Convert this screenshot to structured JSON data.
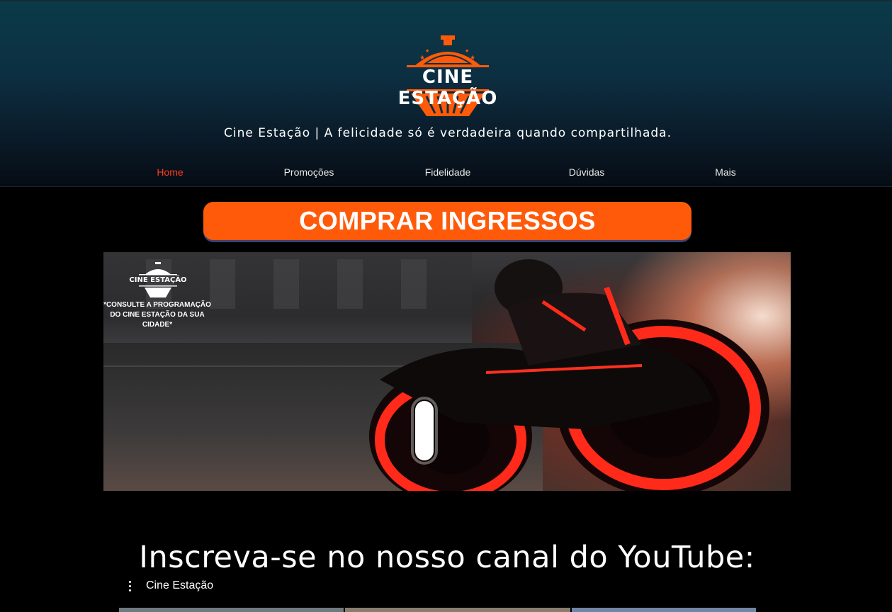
{
  "header": {
    "logo_text": "CINE ESTAÇÃO",
    "tagline": "Cine Estação |  A felicidade só é verdadeira quando compartilhada.",
    "brand_color": "#ff5a0a"
  },
  "nav": {
    "items": [
      {
        "label": "Home",
        "active": true
      },
      {
        "label": "Promoções",
        "active": false
      },
      {
        "label": "Fidelidade",
        "active": false
      },
      {
        "label": "Dúvidas",
        "active": false
      },
      {
        "label": "Mais",
        "active": false
      }
    ],
    "active_color": "#ff3b1f"
  },
  "cta": {
    "label": "COMPRAR INGRESSOS"
  },
  "banner": {
    "logo_text": "CINE ESTAÇÃO",
    "note": "*CONSULTE A PROGRAMAÇÃO DO CINE ESTAÇÃO DA SUA CIDADE*"
  },
  "youtube": {
    "title": "Inscreva-se no nosso canal do YouTube:",
    "channel_name": "Cine Estação",
    "menu_icon": "kebab-menu-icon"
  }
}
